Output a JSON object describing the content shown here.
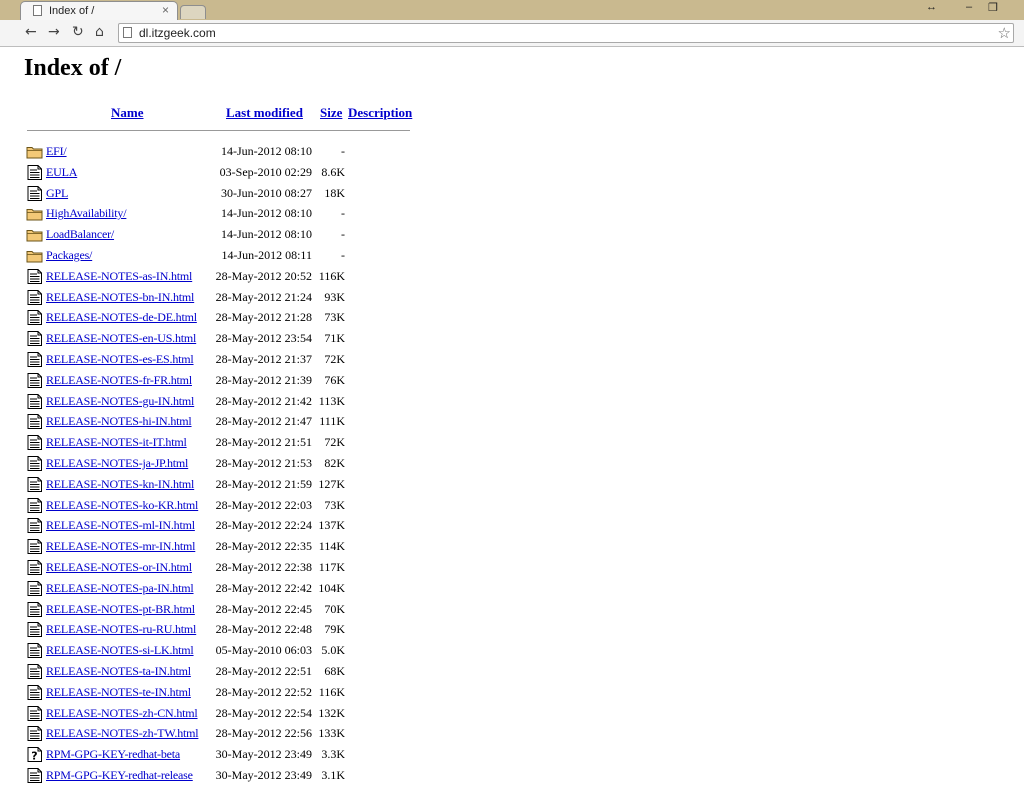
{
  "browser": {
    "tab_title": "Index of /",
    "tab_close": "×",
    "url": "dl.itzgeek.com",
    "window_controls": {
      "restore_arrows": "↔",
      "minimize": "–",
      "maximize": "❐"
    }
  },
  "page": {
    "title": "Index of /",
    "columns": {
      "name": "Name",
      "last_modified": "Last modified",
      "size": "Size",
      "description": "Description"
    }
  },
  "files": [
    {
      "name": "EFI/",
      "modified": "14-Jun-2012 08:10",
      "size": "-",
      "icon": "folder-icon"
    },
    {
      "name": "EULA",
      "modified": "03-Sep-2010 02:29",
      "size": "8.6K",
      "icon": "text-file-icon"
    },
    {
      "name": "GPL",
      "modified": "30-Jun-2010 08:27",
      "size": "18K",
      "icon": "text-file-icon"
    },
    {
      "name": "HighAvailability/",
      "modified": "14-Jun-2012 08:10",
      "size": "-",
      "icon": "folder-icon"
    },
    {
      "name": "LoadBalancer/",
      "modified": "14-Jun-2012 08:10",
      "size": "-",
      "icon": "folder-icon"
    },
    {
      "name": "Packages/",
      "modified": "14-Jun-2012 08:11",
      "size": "-",
      "icon": "folder-icon"
    },
    {
      "name": "RELEASE-NOTES-as-IN.html",
      "modified": "28-May-2012 20:52",
      "size": "116K",
      "icon": "text-file-icon"
    },
    {
      "name": "RELEASE-NOTES-bn-IN.html",
      "modified": "28-May-2012 21:24",
      "size": "93K",
      "icon": "text-file-icon"
    },
    {
      "name": "RELEASE-NOTES-de-DE.html",
      "modified": "28-May-2012 21:28",
      "size": "73K",
      "icon": "text-file-icon"
    },
    {
      "name": "RELEASE-NOTES-en-US.html",
      "modified": "28-May-2012 23:54",
      "size": "71K",
      "icon": "text-file-icon"
    },
    {
      "name": "RELEASE-NOTES-es-ES.html",
      "modified": "28-May-2012 21:37",
      "size": "72K",
      "icon": "text-file-icon"
    },
    {
      "name": "RELEASE-NOTES-fr-FR.html",
      "modified": "28-May-2012 21:39",
      "size": "76K",
      "icon": "text-file-icon"
    },
    {
      "name": "RELEASE-NOTES-gu-IN.html",
      "modified": "28-May-2012 21:42",
      "size": "113K",
      "icon": "text-file-icon"
    },
    {
      "name": "RELEASE-NOTES-hi-IN.html",
      "modified": "28-May-2012 21:47",
      "size": "111K",
      "icon": "text-file-icon"
    },
    {
      "name": "RELEASE-NOTES-it-IT.html",
      "modified": "28-May-2012 21:51",
      "size": "72K",
      "icon": "text-file-icon"
    },
    {
      "name": "RELEASE-NOTES-ja-JP.html",
      "modified": "28-May-2012 21:53",
      "size": "82K",
      "icon": "text-file-icon"
    },
    {
      "name": "RELEASE-NOTES-kn-IN.html",
      "modified": "28-May-2012 21:59",
      "size": "127K",
      "icon": "text-file-icon"
    },
    {
      "name": "RELEASE-NOTES-ko-KR.html",
      "modified": "28-May-2012 22:03",
      "size": "73K",
      "icon": "text-file-icon"
    },
    {
      "name": "RELEASE-NOTES-ml-IN.html",
      "modified": "28-May-2012 22:24",
      "size": "137K",
      "icon": "text-file-icon"
    },
    {
      "name": "RELEASE-NOTES-mr-IN.html",
      "modified": "28-May-2012 22:35",
      "size": "114K",
      "icon": "text-file-icon"
    },
    {
      "name": "RELEASE-NOTES-or-IN.html",
      "modified": "28-May-2012 22:38",
      "size": "117K",
      "icon": "text-file-icon"
    },
    {
      "name": "RELEASE-NOTES-pa-IN.html",
      "modified": "28-May-2012 22:42",
      "size": "104K",
      "icon": "text-file-icon"
    },
    {
      "name": "RELEASE-NOTES-pt-BR.html",
      "modified": "28-May-2012 22:45",
      "size": "70K",
      "icon": "text-file-icon"
    },
    {
      "name": "RELEASE-NOTES-ru-RU.html",
      "modified": "28-May-2012 22:48",
      "size": "79K",
      "icon": "text-file-icon"
    },
    {
      "name": "RELEASE-NOTES-si-LK.html",
      "modified": "05-May-2010 06:03",
      "size": "5.0K",
      "icon": "text-file-icon"
    },
    {
      "name": "RELEASE-NOTES-ta-IN.html",
      "modified": "28-May-2012 22:51",
      "size": "68K",
      "icon": "text-file-icon"
    },
    {
      "name": "RELEASE-NOTES-te-IN.html",
      "modified": "28-May-2012 22:52",
      "size": "116K",
      "icon": "text-file-icon"
    },
    {
      "name": "RELEASE-NOTES-zh-CN.html",
      "modified": "28-May-2012 22:54",
      "size": "132K",
      "icon": "text-file-icon"
    },
    {
      "name": "RELEASE-NOTES-zh-TW.html",
      "modified": "28-May-2012 22:56",
      "size": "133K",
      "icon": "text-file-icon"
    },
    {
      "name": "RPM-GPG-KEY-redhat-beta",
      "modified": "30-May-2012 23:49",
      "size": "3.3K",
      "icon": "unknown-file-icon"
    },
    {
      "name": "RPM-GPG-KEY-redhat-release",
      "modified": "30-May-2012 23:49",
      "size": "3.1K",
      "icon": "text-file-icon"
    }
  ]
}
